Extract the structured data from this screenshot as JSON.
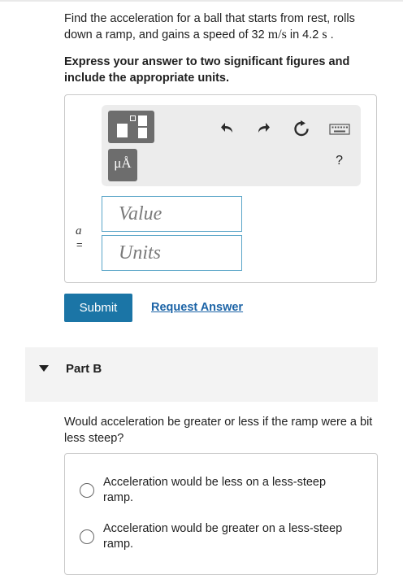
{
  "question": {
    "text_before": "Find the acceleration for a ball that starts from rest, rolls down a ramp, and gains a speed of 32 ",
    "speed_unit": "m/s",
    "text_mid": " in 4.2 ",
    "time_unit": "s",
    "text_end": " ."
  },
  "instructions": "Express your answer to two significant figures and include the appropriate units.",
  "toolbar": {
    "template_icon": "fraction-template-icon",
    "units_symbol": "μÅ",
    "undo_icon": "undo-icon",
    "redo_icon": "redo-icon",
    "reset_icon": "reset-icon",
    "keyboard_icon": "keyboard-icon",
    "help_label": "?"
  },
  "answer": {
    "variable": "a",
    "equals": "=",
    "value_placeholder": "Value",
    "units_placeholder": "Units"
  },
  "actions": {
    "submit_label": "Submit",
    "request_label": "Request Answer"
  },
  "part_b": {
    "label": "Part B",
    "question": "Would acceleration be greater or less if the ramp were a bit less steep?",
    "options": [
      {
        "label": "Acceleration would be less on a less-steep ramp."
      },
      {
        "label": "Acceleration would be greater on a less-steep ramp."
      }
    ]
  },
  "colors": {
    "submit_bg": "#1b75a6",
    "link": "#1b63a6",
    "input_border": "#5aa5c8"
  }
}
